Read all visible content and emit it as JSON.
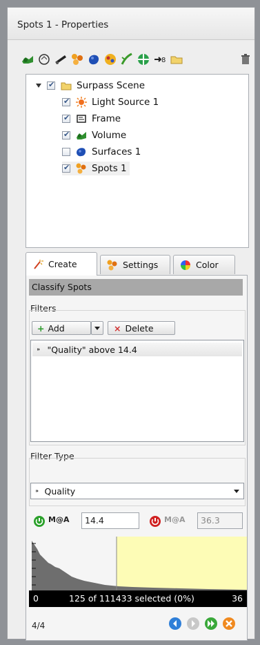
{
  "window": {
    "title": "Spots 1 - Properties"
  },
  "toolbar": {
    "icons": [
      "volume-icon",
      "camera-icon",
      "measure-icon",
      "spots-icon",
      "surfaces-icon",
      "cells-icon",
      "filaments-icon",
      "reference-frame-icon",
      "tracks-icon",
      "folder-icon",
      "delete-icon"
    ]
  },
  "tree": {
    "items": [
      {
        "label": "Surpass Scene",
        "checked": true,
        "icon": "folder-icon"
      },
      {
        "label": "Light Source 1",
        "checked": true,
        "icon": "light-icon"
      },
      {
        "label": "Frame",
        "checked": true,
        "icon": "frame-icon"
      },
      {
        "label": "Volume",
        "checked": true,
        "icon": "volume-icon"
      },
      {
        "label": "Surfaces 1",
        "checked": false,
        "icon": "surfaces-icon"
      },
      {
        "label": "Spots 1",
        "checked": true,
        "icon": "spots-icon"
      }
    ]
  },
  "tabs": [
    {
      "label": "Create"
    },
    {
      "label": "Settings"
    },
    {
      "label": "Color"
    }
  ],
  "panel": {
    "header": "Classify Spots",
    "filters_label": "Filters",
    "add_label": "Add",
    "delete_label": "Delete",
    "filter_entry": "\"Quality\" above 14.4",
    "filter_type_label": "Filter Type",
    "filter_type_value": "Quality",
    "lower_label": "M@A",
    "lower_value": "14.4",
    "upper_label": "M@A",
    "upper_value": "36.3",
    "histogram_min": "0",
    "selection_text": "125 of 111433 selected (0%)",
    "histogram_max": "36",
    "page_counter": "4/4"
  },
  "colors": {
    "classify_bar": "#a8a8a8",
    "threshold_region": "#fdfcb6",
    "histogram_fill": "#6e6e6e"
  }
}
